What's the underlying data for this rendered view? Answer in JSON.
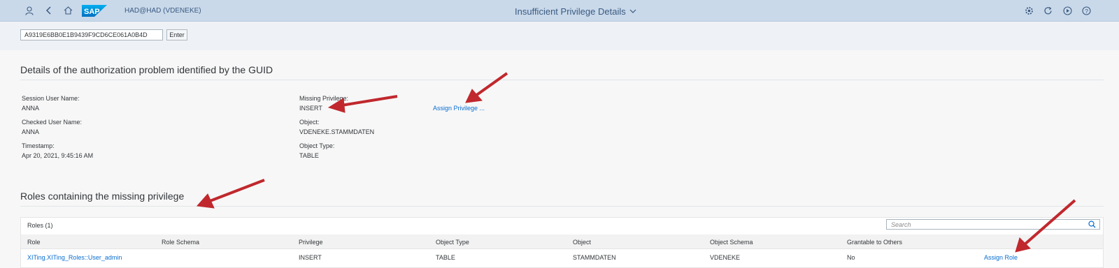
{
  "shell": {
    "system_label": "HAD@HAD (VDENEKE)",
    "title": "Insufficient Privilege Details",
    "logo_text": "SAP"
  },
  "guid_input": {
    "value": "A9319E6BB0E1B9439F9CD6CE061A0B4D"
  },
  "enter_label": "Enter",
  "details": {
    "heading": "Details of the authorization problem identified by the GUID",
    "session_user_label": "Session User Name:",
    "session_user_value": "ANNA",
    "checked_user_label": "Checked User Name:",
    "checked_user_value": "ANNA",
    "timestamp_label": "Timestamp:",
    "timestamp_value": "Apr 20, 2021, 9:45:16 AM",
    "missing_privilege_label": "Missing Privilege:",
    "missing_privilege_value": "INSERT",
    "object_label": "Object:",
    "object_value": "VDENEKE.STAMMDATEN",
    "object_type_label": "Object Type:",
    "object_type_value": "TABLE",
    "assign_privilege_link": "Assign Privilege ..."
  },
  "roles": {
    "heading": "Roles containing the missing privilege",
    "count_label": "Roles (1)",
    "search_placeholder": "Search",
    "columns": [
      "Role",
      "Role Schema",
      "Privilege",
      "Object Type",
      "Object",
      "Object Schema",
      "Grantable to Others",
      ""
    ],
    "rows": [
      {
        "role": "XITing.XITing_Roles::User_admin",
        "role_schema": "",
        "privilege": "INSERT",
        "object_type": "TABLE",
        "object": "STAMMDATEN",
        "object_schema": "VDENEKE",
        "grantable": "No",
        "action": "Assign Role"
      }
    ]
  },
  "colors": {
    "shell_bg": "#c9d9ea",
    "link": "#0a6ed1",
    "arrow": "#c0282d"
  },
  "icons": [
    "user-icon",
    "back-icon",
    "home-icon",
    "settings-icon",
    "refresh-icon",
    "play-icon",
    "help-icon",
    "search-icon",
    "chevron-down-icon"
  ]
}
